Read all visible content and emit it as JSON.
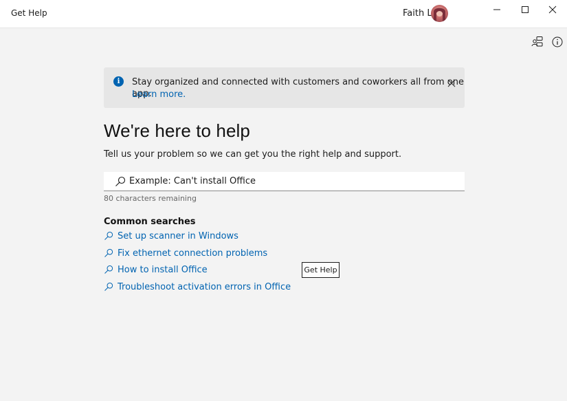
{
  "window": {
    "app_title": "Get Help",
    "user_name": "Faith L",
    "controls": [
      "minimize-icon",
      "maximize-icon",
      "close-icon"
    ]
  },
  "toolbar": {
    "icons": [
      "community-icon",
      "info-circle-icon"
    ]
  },
  "banner": {
    "icon": "info-icon",
    "message": "Stay organized and connected with customers and coworkers all from one app.",
    "link": "Learn more.",
    "close_icon": "close-icon"
  },
  "main": {
    "title": "We're here to help",
    "subtitle": "Tell us your problem so we can get you the right help and support.",
    "search": {
      "placeholder": "Example: Can't install Office",
      "value": "",
      "icon": "search-icon"
    },
    "chars_remaining": "80 characters remaining",
    "common_heading": "Common searches",
    "common_searches": [
      "Set up scanner in Windows",
      "Fix ethernet connection problems",
      "How to install Office",
      "Troubleshoot activation errors in Office"
    ],
    "get_help_label": "Get Help"
  },
  "colors": {
    "accent": "#0063b1",
    "background": "#f3f3f3",
    "banner": "#e6e6e6"
  }
}
